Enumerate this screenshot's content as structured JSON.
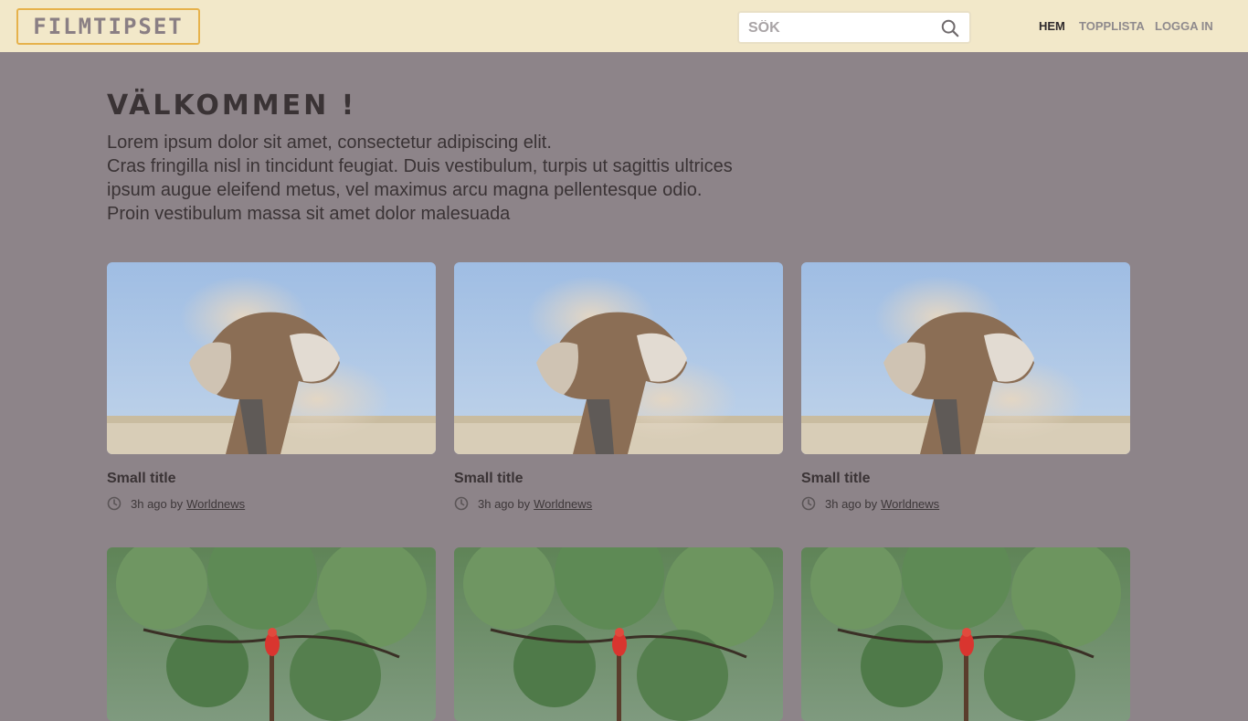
{
  "header": {
    "logo_text": "FILMTIPSET",
    "search": {
      "placeholder": "SÖK",
      "value": ""
    },
    "nav": [
      {
        "label": "HEM",
        "active": true
      },
      {
        "label": "TOPPLISTA",
        "active": false
      },
      {
        "label": "LOGGA IN",
        "active": false
      }
    ]
  },
  "main": {
    "title": "VÄLKOMMEN !",
    "intro_lines": [
      "Lorem ipsum dolor sit amet, consectetur adipiscing elit.",
      "Cras fringilla nisl in tincidunt feugiat. Duis vestibulum, turpis ut sagittis ultrices",
      "ipsum augue eleifend metus, vel maximus arcu magna pellentesque odio.",
      "Proin vestibulum massa sit amet dolor malesuada"
    ],
    "cards_row1": [
      {
        "title": "Small title",
        "time": "3h ago by",
        "author": "Worldnews",
        "image": "elephant-dust-photo"
      },
      {
        "title": "Small title",
        "time": "3h ago by",
        "author": "Worldnews",
        "image": "elephant-dust-photo"
      },
      {
        "title": "Small title",
        "time": "3h ago by",
        "author": "Worldnews",
        "image": "elephant-dust-photo"
      }
    ],
    "cards_row2": [
      {
        "image": "parrot-tree-photo"
      },
      {
        "image": "parrot-tree-photo"
      },
      {
        "image": "parrot-tree-photo"
      }
    ]
  },
  "colors": {
    "page_bg": "#8d8489",
    "header_bg": "#f2e8c9",
    "logo_border": "#e6b24c",
    "sky": "#a7c4e6",
    "foliage": "#5d7f4e"
  }
}
